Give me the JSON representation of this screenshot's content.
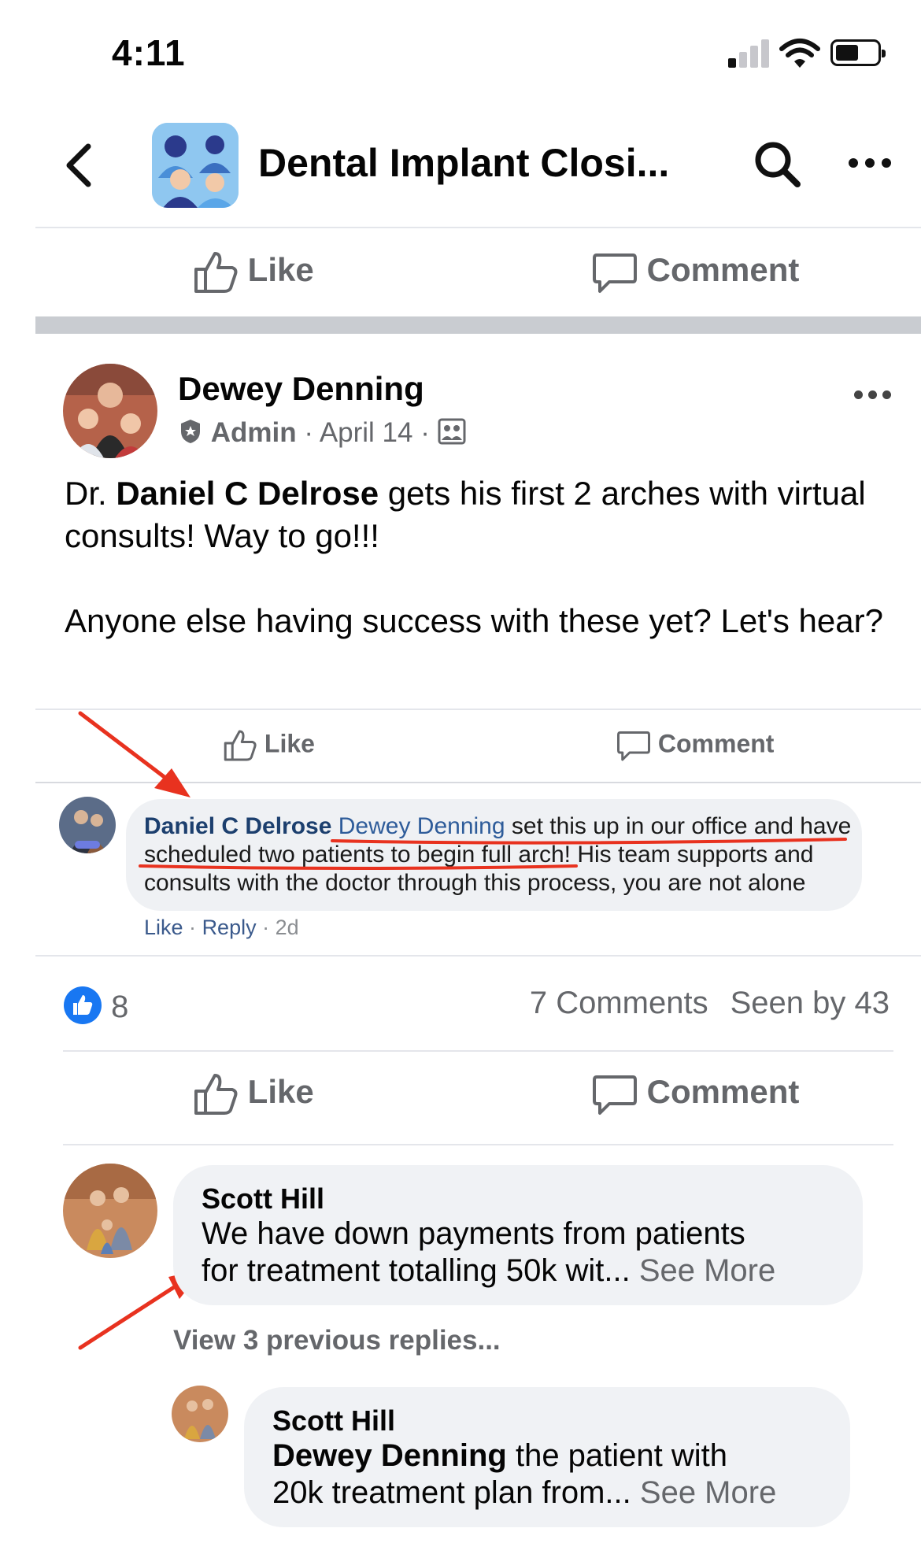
{
  "status_bar": {
    "time": "4:11"
  },
  "header": {
    "back_icon": "chevron-left-icon",
    "title": "Dental Implant Closi...",
    "search_icon": "search-icon",
    "more_icon": "more-dots-icon"
  },
  "top_actions": {
    "like": "Like",
    "comment": "Comment"
  },
  "post": {
    "author": "Dewey Denning",
    "role": "Admin",
    "sep": "·",
    "date": "April 14",
    "body_prefix": "Dr. ",
    "body_bold": "Daniel C Delrose",
    "body_rest": " gets his first 2 arches with virtual consults!  Way to go!!!",
    "body_p2": "Anyone else having success with these yet?  Let's hear?",
    "inner_actions": {
      "like": "Like",
      "comment": "Comment"
    },
    "inner_comment": {
      "author": "Daniel C Delrose",
      "mention": "Dewey Denning",
      "text": " set this up in our office and have scheduled two patients to begin full arch! His team supports and consults with the doctor through this process, you are not alone",
      "like": "Like",
      "dot": "·",
      "reply": "Reply",
      "age": "2d"
    },
    "reaction_count": "8",
    "comments_count": "7 Comments",
    "seen_by": "Seen by 43",
    "actions": {
      "like": "Like",
      "comment": "Comment"
    }
  },
  "comments": [
    {
      "author": "Scott Hill",
      "line1": "We have down payments from patients",
      "line2_a": "for treatment ",
      "line2_b": "totalling 50k",
      "line2_c": " wit...",
      "see_more": "See More"
    }
  ],
  "view_replies": "View 3 previous replies...",
  "reply": {
    "author": "Scott Hill",
    "mention": "Dewey Denning",
    "line1_rest": "  the patient with",
    "line2": "20k treatment plan from...",
    "see_more": "See More"
  },
  "colors": {
    "like_blue": "#1877f2",
    "annotation_red": "#e8321f",
    "muted": "#65676b"
  }
}
